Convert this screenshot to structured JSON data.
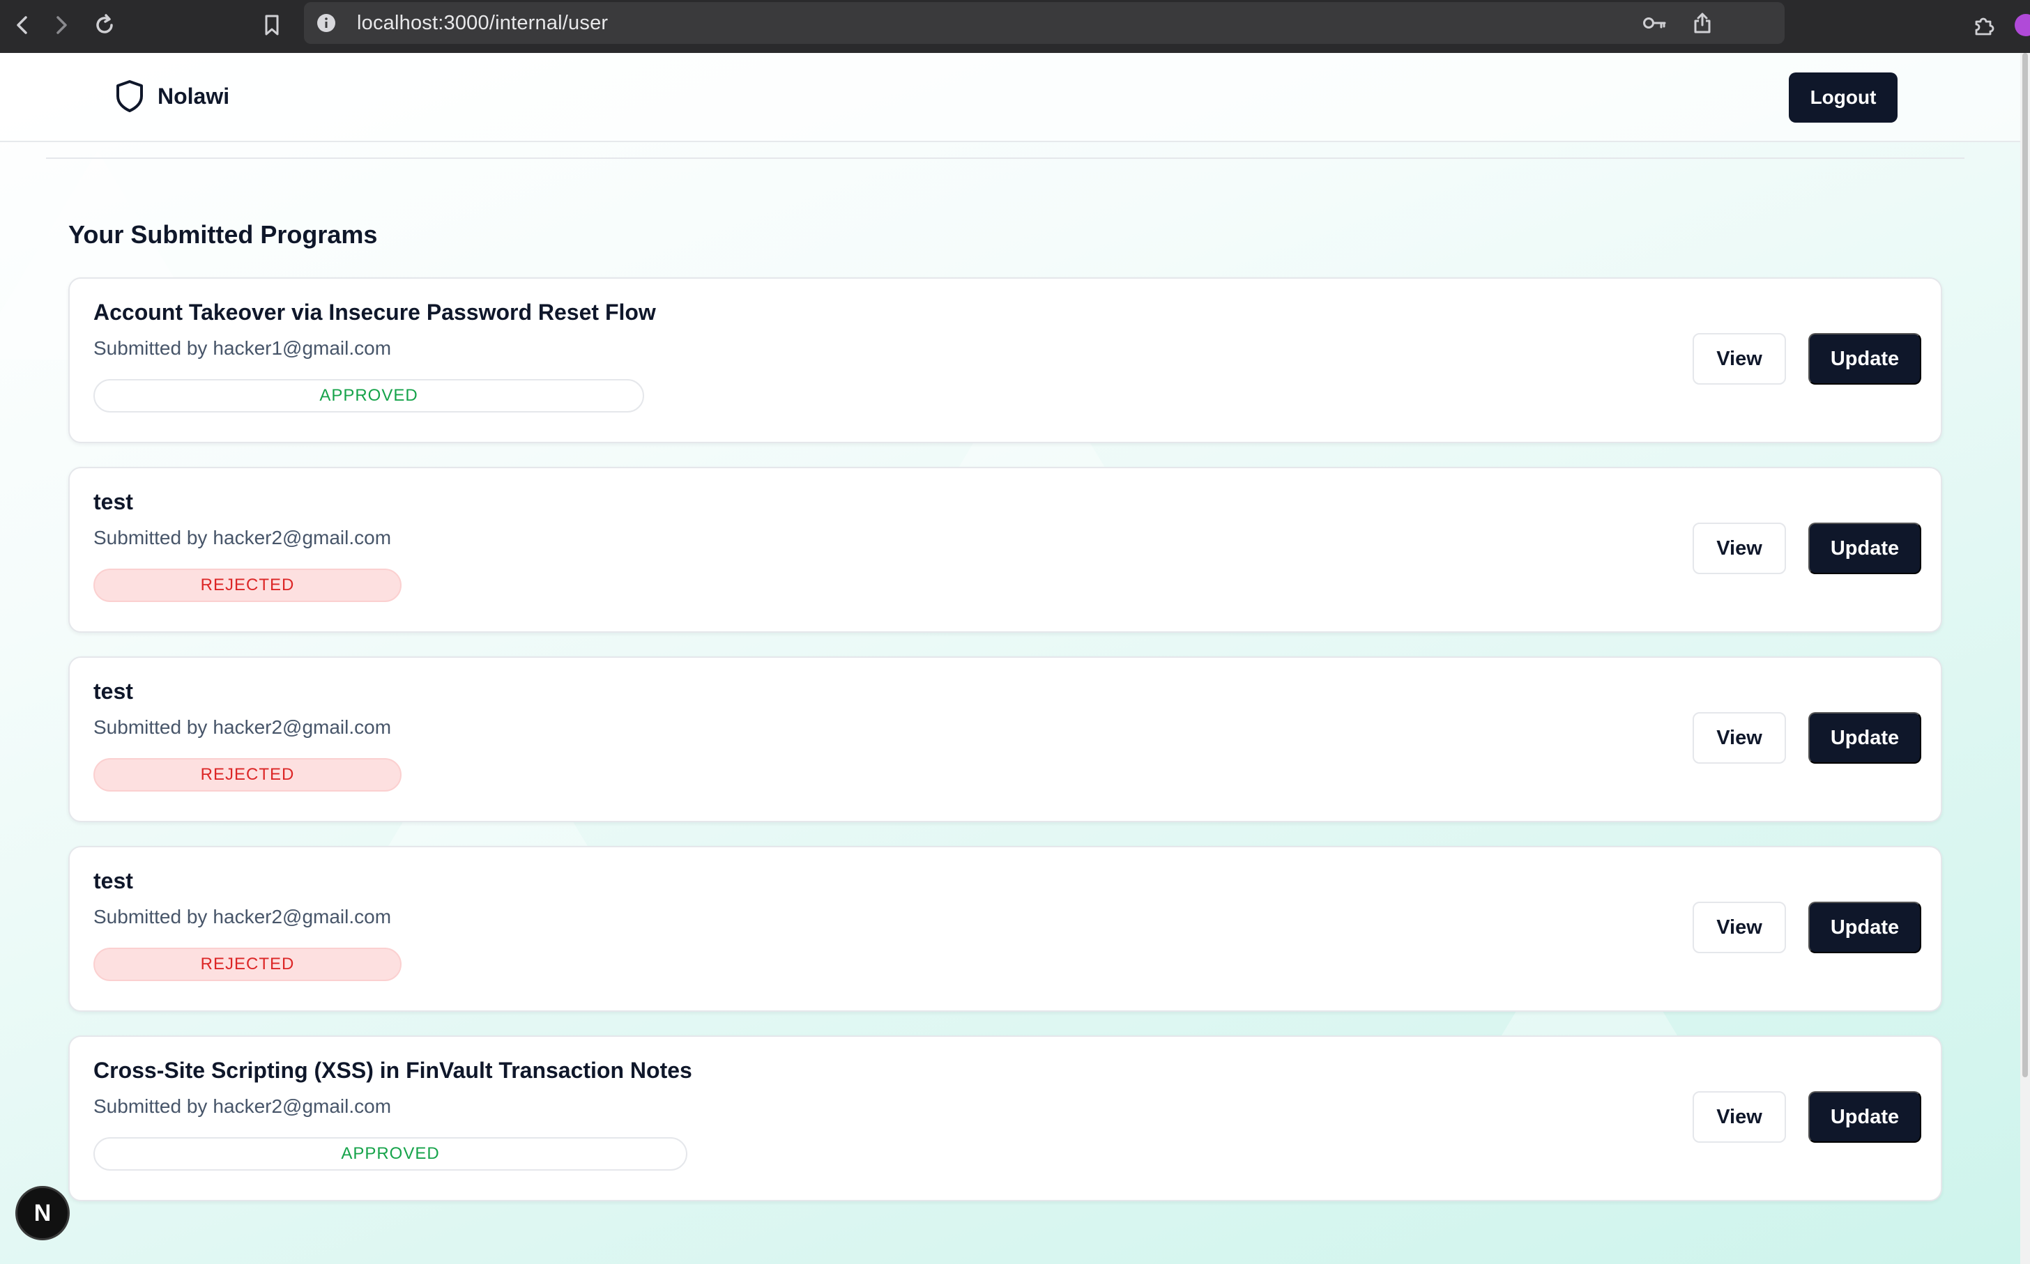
{
  "browser": {
    "url": "localhost:3000/internal/user",
    "icons": [
      "back-icon",
      "forward-icon",
      "reload-icon",
      "bookmark-icon",
      "site-info-icon",
      "key-icon",
      "share-icon",
      "brave-shield-icon",
      "extensions-icon"
    ]
  },
  "header": {
    "brand": "Nolawi",
    "logout_label": "Logout"
  },
  "main": {
    "section_title": "Your Submitted Programs",
    "submitted_by_label": "Submitted by",
    "view_label": "View",
    "update_label": "Update",
    "programs": [
      {
        "title": "Account Takeover via Insecure Password Reset Flow",
        "submitter": "hacker1@gmail.com",
        "status": "APPROVED"
      },
      {
        "title": "test",
        "submitter": "hacker2@gmail.com",
        "status": "REJECTED"
      },
      {
        "title": "test",
        "submitter": "hacker2@gmail.com",
        "status": "REJECTED"
      },
      {
        "title": "test",
        "submitter": "hacker2@gmail.com",
        "status": "REJECTED"
      },
      {
        "title": "Cross-Site Scripting (XSS) in FinVault Transaction Notes",
        "submitter": "hacker2@gmail.com",
        "status": "APPROVED"
      }
    ]
  },
  "dev_indicator": {
    "label": "N"
  },
  "colors": {
    "primary": "#0f172a",
    "approved": "#16a34a",
    "rejected": "#dc2626",
    "rejected_bg": "#fde0e0"
  }
}
